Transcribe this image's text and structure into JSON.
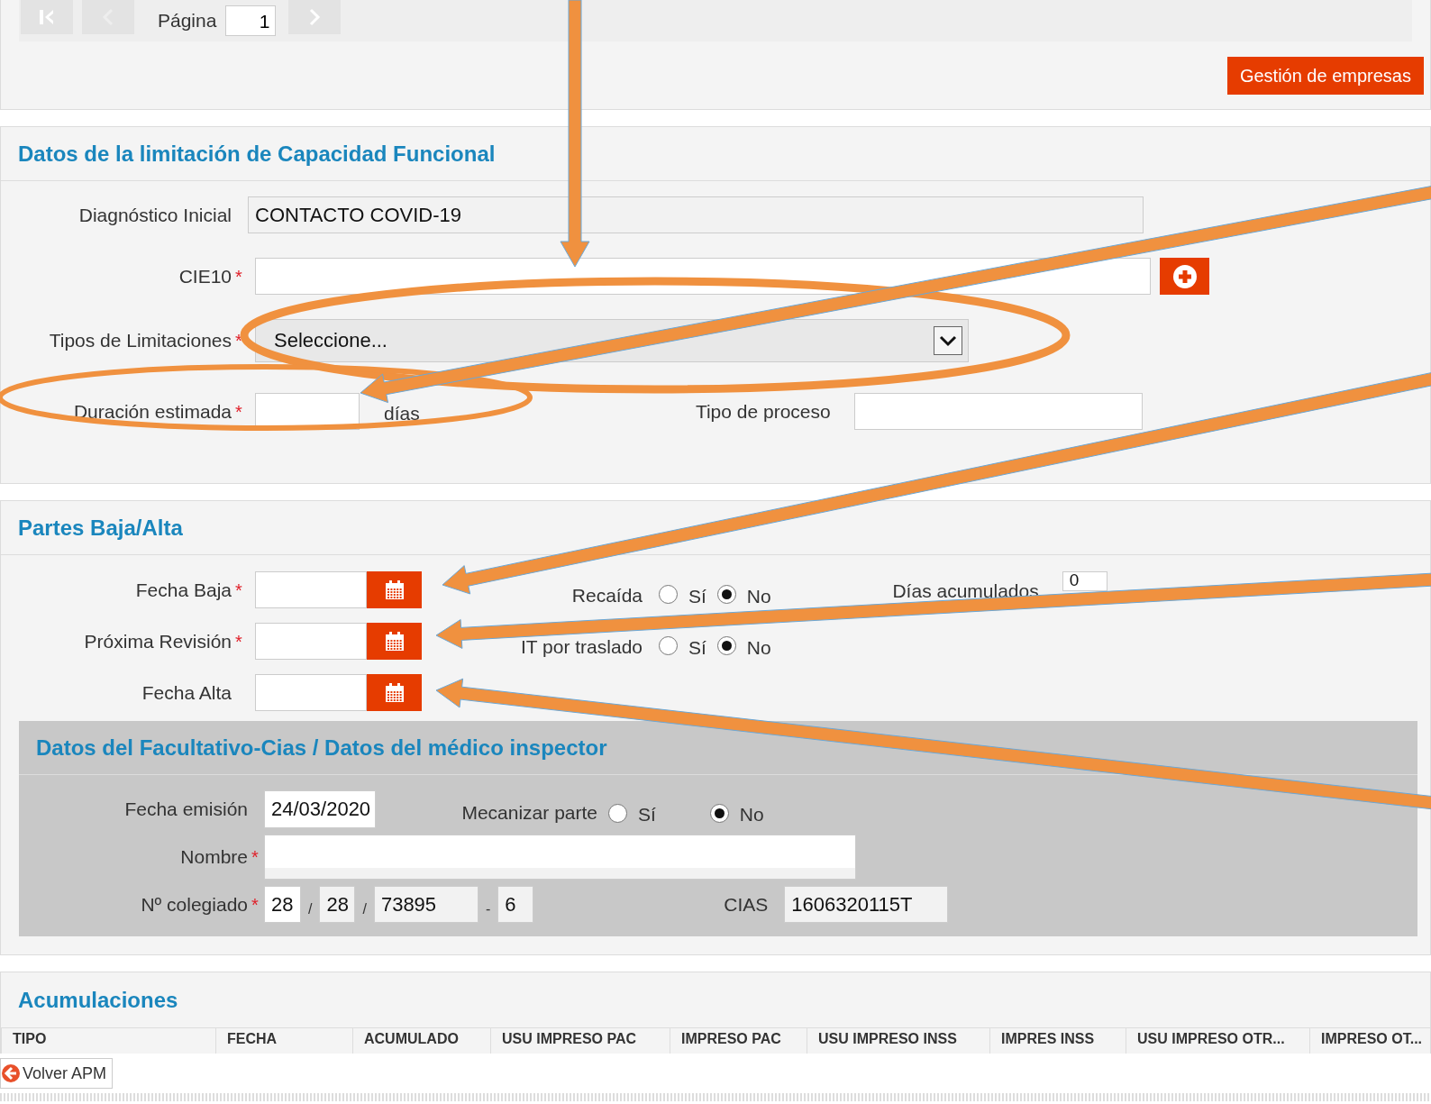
{
  "pager": {
    "page_label": "Página",
    "page_value": "1"
  },
  "company_button": "Gestión de empresas",
  "limitation": {
    "title": "Datos de la limitación de Capacidad Funcional",
    "diagnosis": {
      "label": "Diagnóstico Inicial",
      "value": "CONTACTO COVID-19"
    },
    "cie10": {
      "label": "CIE10",
      "required_mark": "*"
    },
    "limitation_types": {
      "label": "Tipos de Limitaciones",
      "required_mark": "*",
      "value": "Seleccione..."
    },
    "duration": {
      "label": "Duración estimada",
      "required_mark": "*",
      "unit": "días"
    },
    "process_type": {
      "label": "Tipo de proceso"
    }
  },
  "partes": {
    "title": "Partes Baja/Alta",
    "dates": [
      {
        "label": "Fecha Baja",
        "required_mark": "*"
      },
      {
        "label": "Próxima Revisión",
        "required_mark": "*"
      },
      {
        "label": "Fecha Alta"
      }
    ],
    "options": [
      {
        "label": "Recaída",
        "choices": [
          {
            "label": "Sí",
            "selected": false
          },
          {
            "label": "No",
            "selected": true
          }
        ]
      },
      {
        "label": "IT por traslado",
        "choices": [
          {
            "label": "Sí",
            "selected": false
          },
          {
            "label": "No",
            "selected": true
          }
        ]
      }
    ],
    "accumulated_days": {
      "label": "Días acumulados",
      "value": "0"
    },
    "doctor": {
      "title": "Datos del Facultativo-Cias / Datos del médico inspector",
      "issue_date": {
        "label": "Fecha emisión",
        "value": "24/03/2020"
      },
      "mechanize": {
        "label": "Mecanizar parte",
        "choices": [
          {
            "label": "Sí",
            "selected": false
          },
          {
            "label": "No",
            "selected": true
          }
        ]
      },
      "name": {
        "label": "Nombre",
        "required_mark": "*"
      },
      "license": {
        "label": "Nº colegiado",
        "required_mark": "*",
        "parts": [
          "28",
          "28",
          "73895",
          "6"
        ],
        "separators": [
          "/",
          "/",
          "-"
        ]
      },
      "cias": {
        "label": "CIAS",
        "value": "1606320115T"
      }
    }
  },
  "accumulations": {
    "title": "Acumulaciones",
    "columns": [
      "TIPO",
      "FECHA",
      "ACUMULADO",
      "USU IMPRESO PAC",
      "IMPRESO PAC",
      "USU IMPRESO INSS",
      "IMPRES INSS",
      "USU IMPRESO OTR...",
      "IMPRESO OT..."
    ]
  },
  "footer": {
    "back_button": "Volver APM"
  }
}
